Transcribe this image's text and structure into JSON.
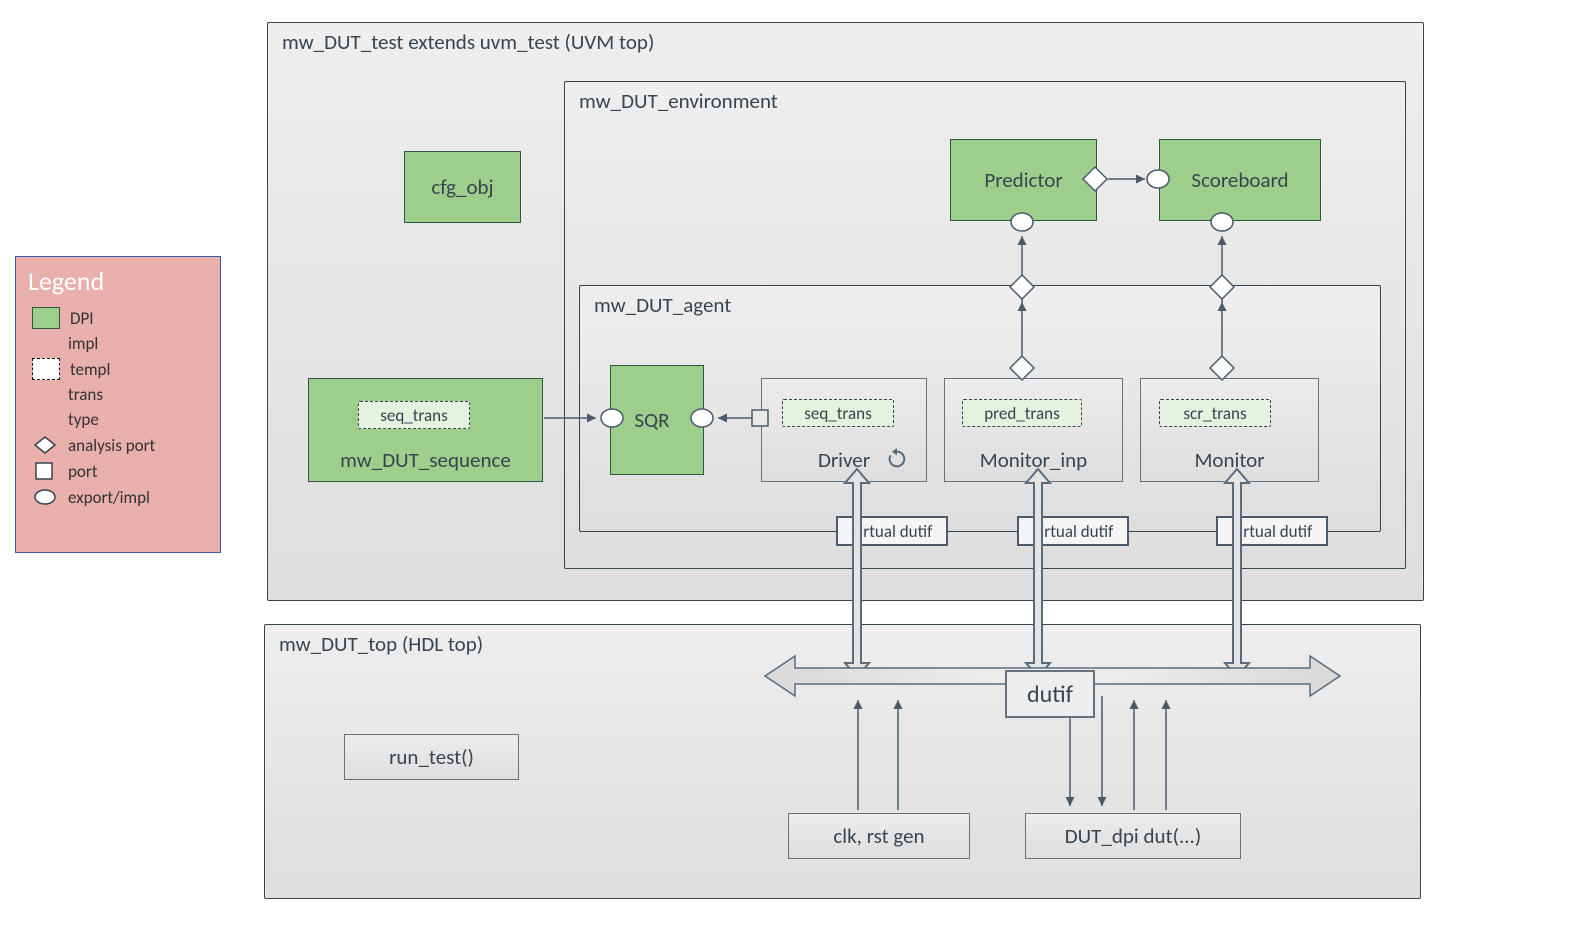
{
  "legend": {
    "title": "Legend",
    "dpi": "DPI",
    "impl": "impl",
    "templ": "templ",
    "trans": "trans",
    "type": "type",
    "analysis_port": "analysis port",
    "port": "port",
    "export_impl": "export/impl"
  },
  "test": {
    "title": "mw_DUT_test extends uvm_test (UVM top)",
    "cfg_obj": "cfg_obj",
    "sequence": {
      "title": "mw_DUT_sequence",
      "trans": "seq_trans"
    }
  },
  "env": {
    "title": "mw_DUT_environment",
    "predictor": "Predictor",
    "scoreboard": "Scoreboard"
  },
  "agent": {
    "title": "mw_DUT_agent",
    "sqr": "SQR",
    "driver": {
      "label": "Driver",
      "trans": "seq_trans",
      "virtif": "virtual dutif"
    },
    "mon_inp": {
      "label": "Monitor_inp",
      "trans": "pred_trans",
      "virtif": "virtual dutif"
    },
    "mon": {
      "label": "Monitor",
      "trans": "scr_trans",
      "virtif": "virtual dutif"
    }
  },
  "top": {
    "title": "mw_DUT_top  (HDL top)",
    "run_test": "run_test()",
    "dutif": "dutif",
    "clk": "clk, rst gen",
    "dut": "DUT_dpi dut(...)"
  }
}
